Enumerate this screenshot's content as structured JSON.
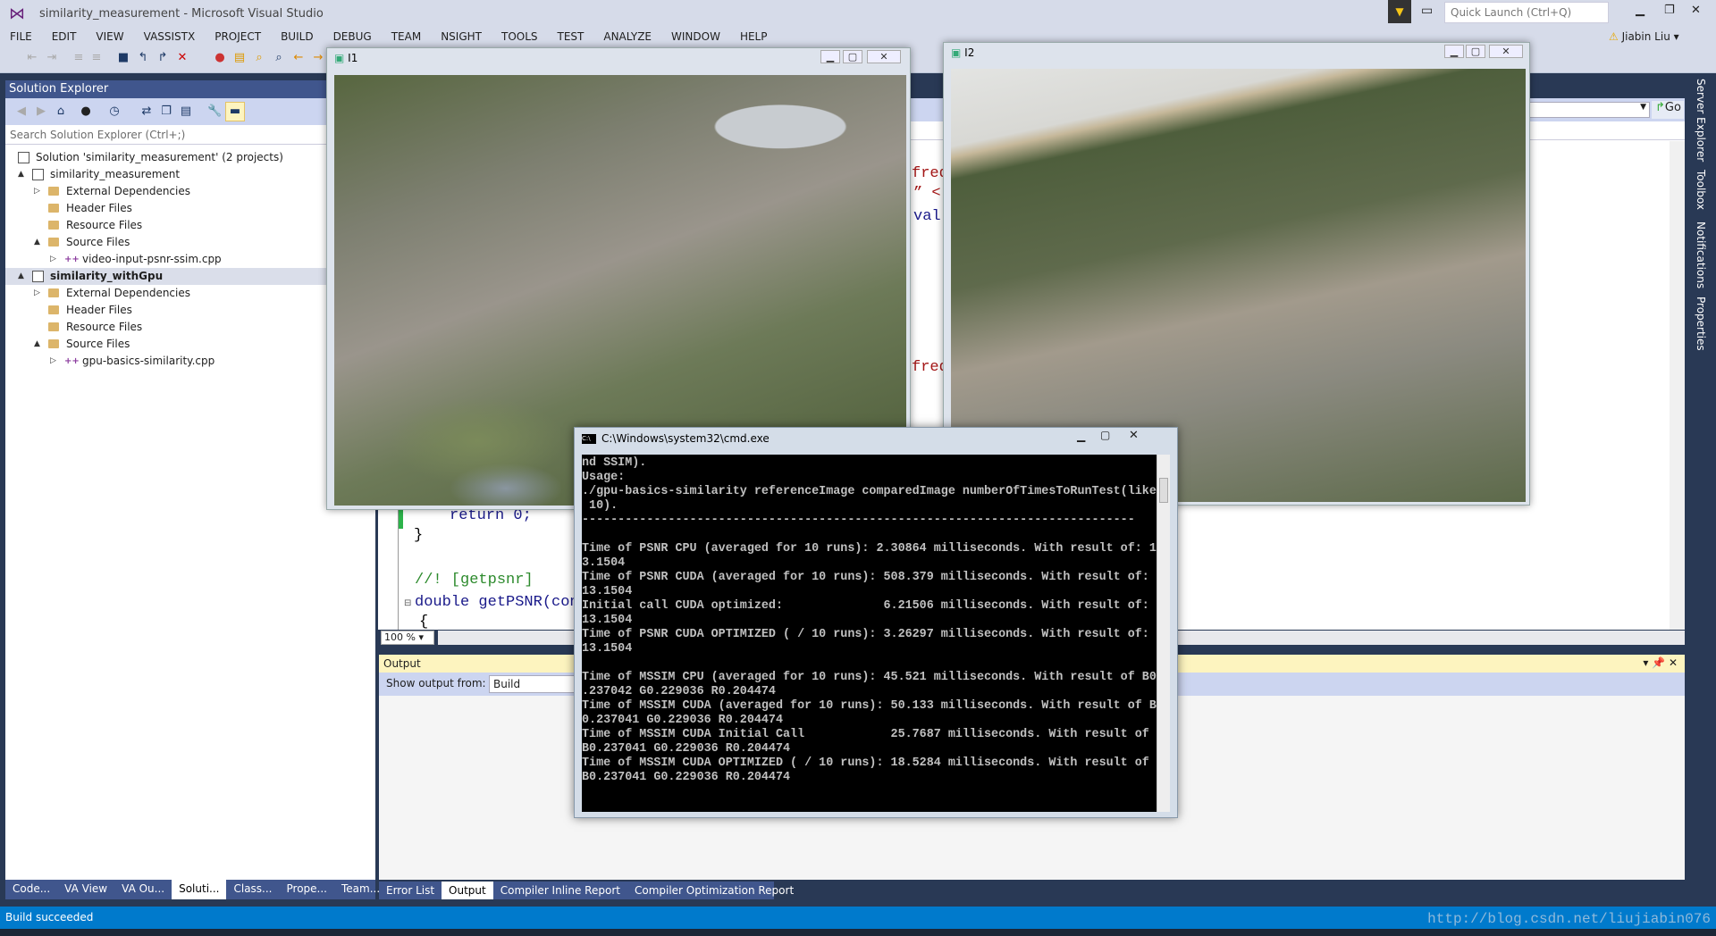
{
  "window": {
    "title": "similarity_measurement - Microsoft Visual Studio",
    "quick_launch_placeholder": "Quick Launch (Ctrl+Q)",
    "user": "Jiabin Liu"
  },
  "menu": [
    "FILE",
    "EDIT",
    "VIEW",
    "VASSISTX",
    "PROJECT",
    "BUILD",
    "DEBUG",
    "TEAM",
    "NSIGHT",
    "TOOLS",
    "TEST",
    "ANALYZE",
    "WINDOW",
    "HELP"
  ],
  "solution_explorer": {
    "title": "Solution Explorer",
    "search_placeholder": "Search Solution Explorer (Ctrl+;)",
    "tree": [
      "Solution 'similarity_measurement' (2 projects)",
      "similarity_measurement",
      "External Dependencies",
      "Header Files",
      "Resource Files",
      "Source Files",
      "video-input-psnr-ssim.cpp",
      "similarity_withGpu",
      "External Dependencies",
      "Header Files",
      "Resource Files",
      "Source Files",
      "gpu-basics-similarity.cpp"
    ],
    "tabs": [
      "Code...",
      "VA View",
      "VA Ou...",
      "Soluti...",
      "Class...",
      "Prope...",
      "Team..."
    ]
  },
  "editor": {
    "lines": [
      "return 0;",
      "}",
      "//! [getpsnr]",
      "double getPSNR(con",
      "{"
    ],
    "fragments": [
      "freq",
      "” <",
      "val",
      "freq"
    ],
    "zoom": "100 %",
    "go": "Go"
  },
  "output": {
    "title": "Output",
    "show_from_label": "Show output from:",
    "show_from_value": "Build",
    "tabs": [
      "Error List",
      "Output",
      "Compiler Inline Report",
      "Compiler Optimization Report"
    ]
  },
  "right_tabs": [
    "Server Explorer",
    "Toolbox",
    "Notifications",
    "Properties"
  ],
  "image_windows": {
    "i1": "I1",
    "i2": "I2"
  },
  "cmd": {
    "title": "C:\\Windows\\system32\\cmd.exe",
    "lines": [
      "nd SSIM).",
      "Usage:",
      "./gpu-basics-similarity referenceImage comparedImage numberOfTimesToRunTest(like",
      " 10).",
      "-----------------------------------------------------------------------------",
      "",
      "Time of PSNR CPU (averaged for 10 runs): 2.30864 milliseconds. With result of: 1",
      "3.1504",
      "Time of PSNR CUDA (averaged for 10 runs): 508.379 milliseconds. With result of:",
      "13.1504",
      "Initial call CUDA optimized:              6.21506 milliseconds. With result of:",
      "13.1504",
      "Time of PSNR CUDA OPTIMIZED ( / 10 runs): 3.26297 milliseconds. With result of:",
      "13.1504",
      "",
      "Time of MSSIM CPU (averaged for 10 runs): 45.521 milliseconds. With result of B0",
      ".237042 G0.229036 R0.204474",
      "Time of MSSIM CUDA (averaged for 10 runs): 50.133 milliseconds. With result of B",
      "0.237041 G0.229036 R0.204474",
      "Time of MSSIM CUDA Initial Call            25.7687 milliseconds. With result of",
      "B0.237041 G0.229036 R0.204474",
      "Time of MSSIM CUDA OPTIMIZED ( / 10 runs): 18.5284 milliseconds. With result of",
      "B0.237041 G0.229036 R0.204474"
    ]
  },
  "status": {
    "text": "Build succeeded",
    "watermark": "http://blog.csdn.net/liujiabin076"
  },
  "colors": {
    "accent": "#007acc",
    "frame": "#293955",
    "panel_header": "#40568d",
    "output_header": "#fdf4bf"
  }
}
